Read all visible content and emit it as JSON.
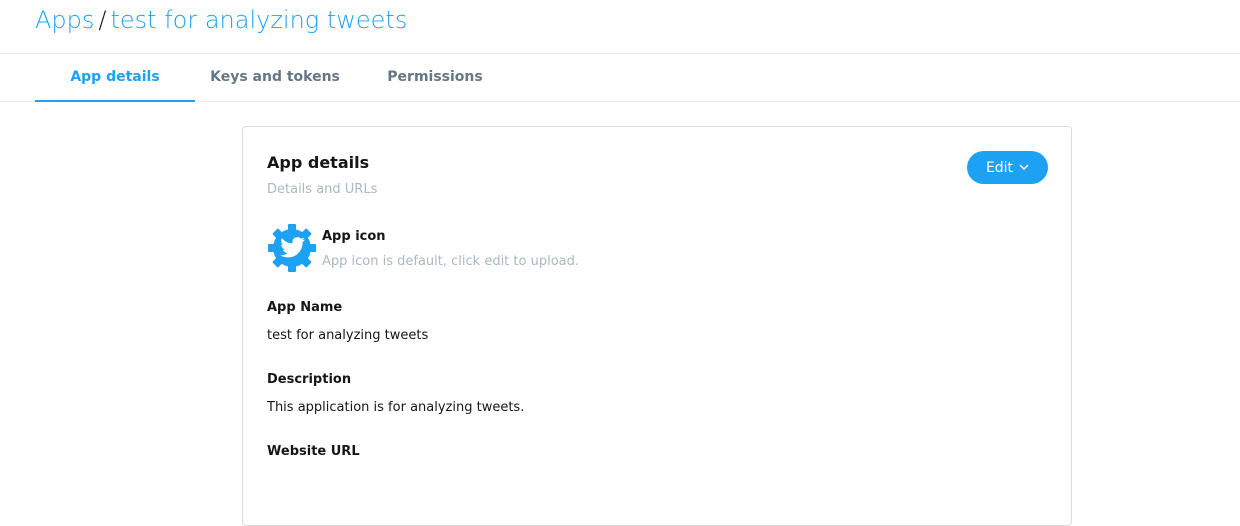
{
  "breadcrumb": {
    "root": "Apps",
    "separator": "/",
    "current": "test for analyzing tweets"
  },
  "tabs": [
    {
      "label": "App details",
      "active": true
    },
    {
      "label": "Keys and tokens",
      "active": false
    },
    {
      "label": "Permissions",
      "active": false
    }
  ],
  "card": {
    "title": "App details",
    "subtitle": "Details and URLs",
    "edit_label": "Edit",
    "app_icon": {
      "title": "App icon",
      "subtitle": "App icon is default, click edit to upload.",
      "icon_name": "twitter-gear-icon"
    },
    "fields": [
      {
        "label": "App Name",
        "value": "test for analyzing tweets"
      },
      {
        "label": "Description",
        "value": "This application is for analyzing tweets."
      },
      {
        "label": "Website URL",
        "value": ""
      }
    ]
  },
  "colors": {
    "accent": "#1da1f2",
    "muted": "#aab8c2",
    "tab_inactive": "#657786"
  }
}
